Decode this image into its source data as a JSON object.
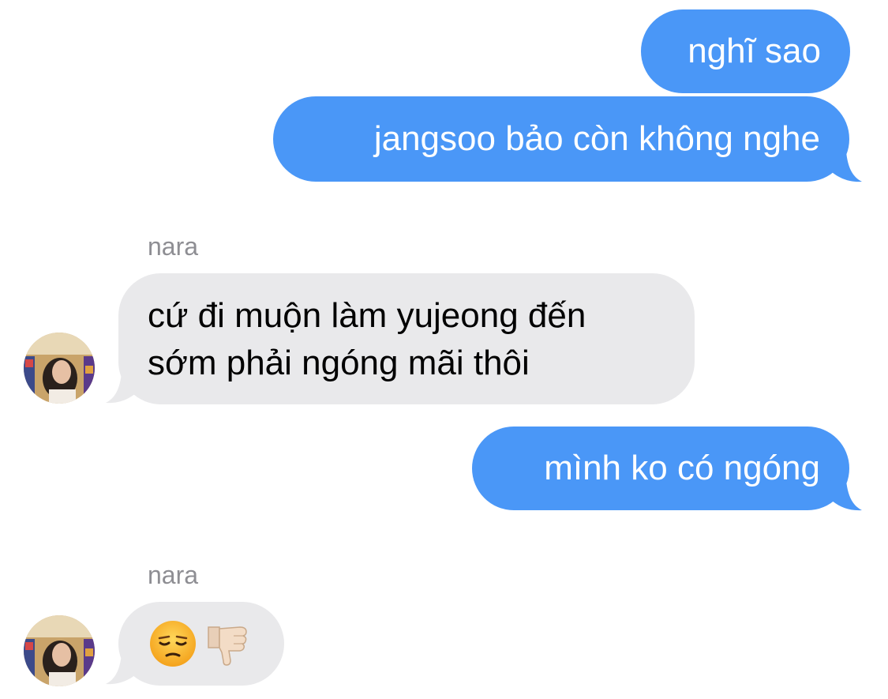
{
  "conversation": {
    "messages": [
      {
        "sender": "me",
        "text": "nghĩ sao"
      },
      {
        "sender": "me",
        "text": "jangsoo bảo còn không nghe"
      },
      {
        "sender": "nara",
        "sender_label": "nara",
        "line1": "cứ đi muộn làm yujeong đến",
        "line2": "sớm phải ngóng mãi thôi"
      },
      {
        "sender": "me",
        "text": "mình ko có ngóng"
      },
      {
        "sender": "nara",
        "sender_label": "nara",
        "emojis": [
          "unamused-face-emoji",
          "thumbs-down-emoji"
        ]
      }
    ]
  },
  "colors": {
    "sent_bubble": "#4a97f7",
    "received_bubble": "#e9e9eb",
    "sender_label": "#8e8e93"
  }
}
